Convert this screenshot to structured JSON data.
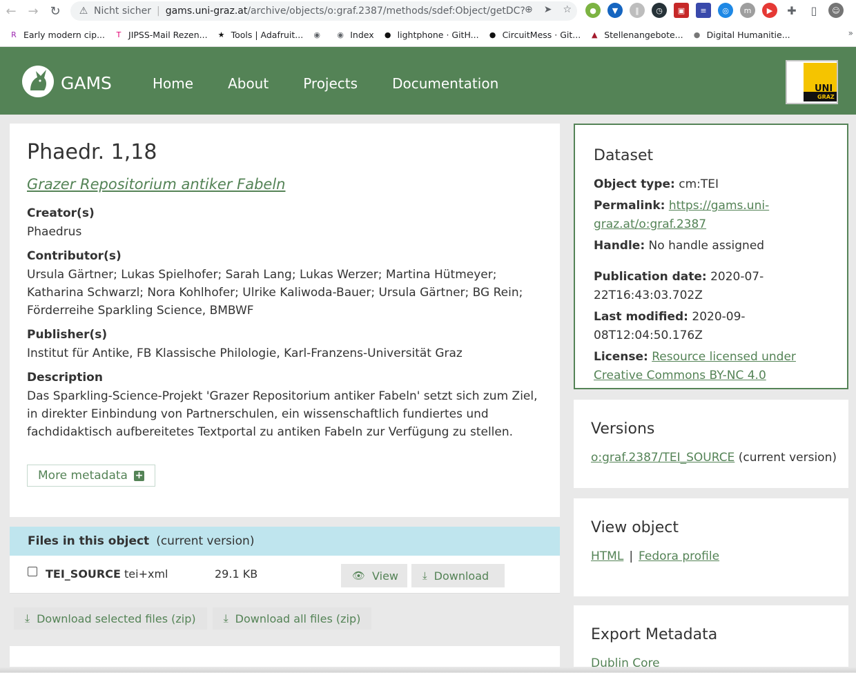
{
  "browser": {
    "insecure_label": "Nicht sicher",
    "url_host": "gams.uni-graz.at",
    "url_path": "/archive/objects/o:graf.2387/methods/sdef:Object/getDC?",
    "bookmarks": [
      {
        "label": "Early modern cip...",
        "icon": "R",
        "color": "#9c27b0"
      },
      {
        "label": "JIPSS-Mail Rezen...",
        "icon": "T",
        "color": "#e20074"
      },
      {
        "label": "Tools | Adafruit...",
        "icon": "★",
        "color": "#111111"
      },
      {
        "label": "",
        "icon": "◉",
        "color": "#5f6368"
      },
      {
        "label": "Index",
        "icon": "◉",
        "color": "#5f6368"
      },
      {
        "label": "lightphone · GitH...",
        "icon": "●",
        "color": "#111111"
      },
      {
        "label": "CircuitMess · Git...",
        "icon": "●",
        "color": "#111111"
      },
      {
        "label": "Stellenangebote...",
        "icon": "▲",
        "color": "#a31a2c"
      },
      {
        "label": "Digital Humanitie...",
        "icon": "●",
        "color": "#777777"
      }
    ],
    "bookmarks_more": "»"
  },
  "header": {
    "brand": "GAMS",
    "nav": [
      "Home",
      "About",
      "Projects",
      "Documentation"
    ],
    "uni_logo_line1": "UNI",
    "uni_logo_line2": "GRAZ"
  },
  "main": {
    "title": "Phaedr. 1,18",
    "collection": "Grazer Repositorium antiker Fabeln",
    "creator_label": "Creator(s)",
    "creator_value": "Phaedrus",
    "contributor_label": "Contributor(s)",
    "contributor_value": "Ursula Gärtner; Lukas Spielhofer; Sarah Lang; Lukas Werzer; Martina Hütmeyer; Katharina Schwarzl; Nora Kohlhofer; Ulrike Kaliwoda-Bauer; Ursula Gärtner; BG Rein; Förderreihe Sparkling Science, BMBWF",
    "publisher_label": "Publisher(s)",
    "publisher_value": "Institut für Antike, FB Klassische Philologie, Karl-Franzens-Universität Graz",
    "description_label": "Description",
    "description_value": "Das Sparkling-Science-Projekt 'Grazer Repositorium antiker Fabeln' setzt sich zum Ziel, in direkter Einbindung von Partnerschulen, ein wissenschaftlich fundiertes und fachdidaktisch aufbereitetes Textportal zu antiken Fabeln zur Verfügung zu stellen.",
    "more_metadata": "More metadata"
  },
  "files": {
    "heading": "Files in this object",
    "heading_note": "(current version)",
    "rows": [
      {
        "name": "TEI_SOURCE",
        "type": "tei+xml",
        "size": "29.1 KB",
        "view": "View",
        "download": "Download"
      }
    ],
    "download_selected": "Download selected files (zip)",
    "download_all": "Download all files (zip)"
  },
  "dataset": {
    "title": "Dataset",
    "object_type_label": "Object type:",
    "object_type": "cm:TEI",
    "permalink_label": "Permalink:",
    "permalink": "https://gams.uni-graz.at/o:graf.2387",
    "handle_label": "Handle:",
    "handle": "No handle assigned",
    "pub_date_label": "Publication date:",
    "pub_date": "2020-07-22T16:43:03.702Z",
    "last_modified_label": "Last modified:",
    "last_modified": "2020-09-08T12:04:50.176Z",
    "license_label": "License:",
    "license": "Resource licensed under Creative Commons BY-NC 4.0"
  },
  "versions": {
    "title": "Versions",
    "link": "o:graf.2387/TEI_SOURCE",
    "note": "(current version)"
  },
  "view_object": {
    "title": "View object",
    "html": "HTML",
    "separator": "|",
    "fedora": "Fedora profile"
  },
  "export": {
    "title": "Export Metadata",
    "dublin_core": "Dublin Core"
  },
  "colors": {
    "brand_green": "#548356",
    "files_header": "#bfe5ee",
    "uni_gold": "#f5c400"
  }
}
